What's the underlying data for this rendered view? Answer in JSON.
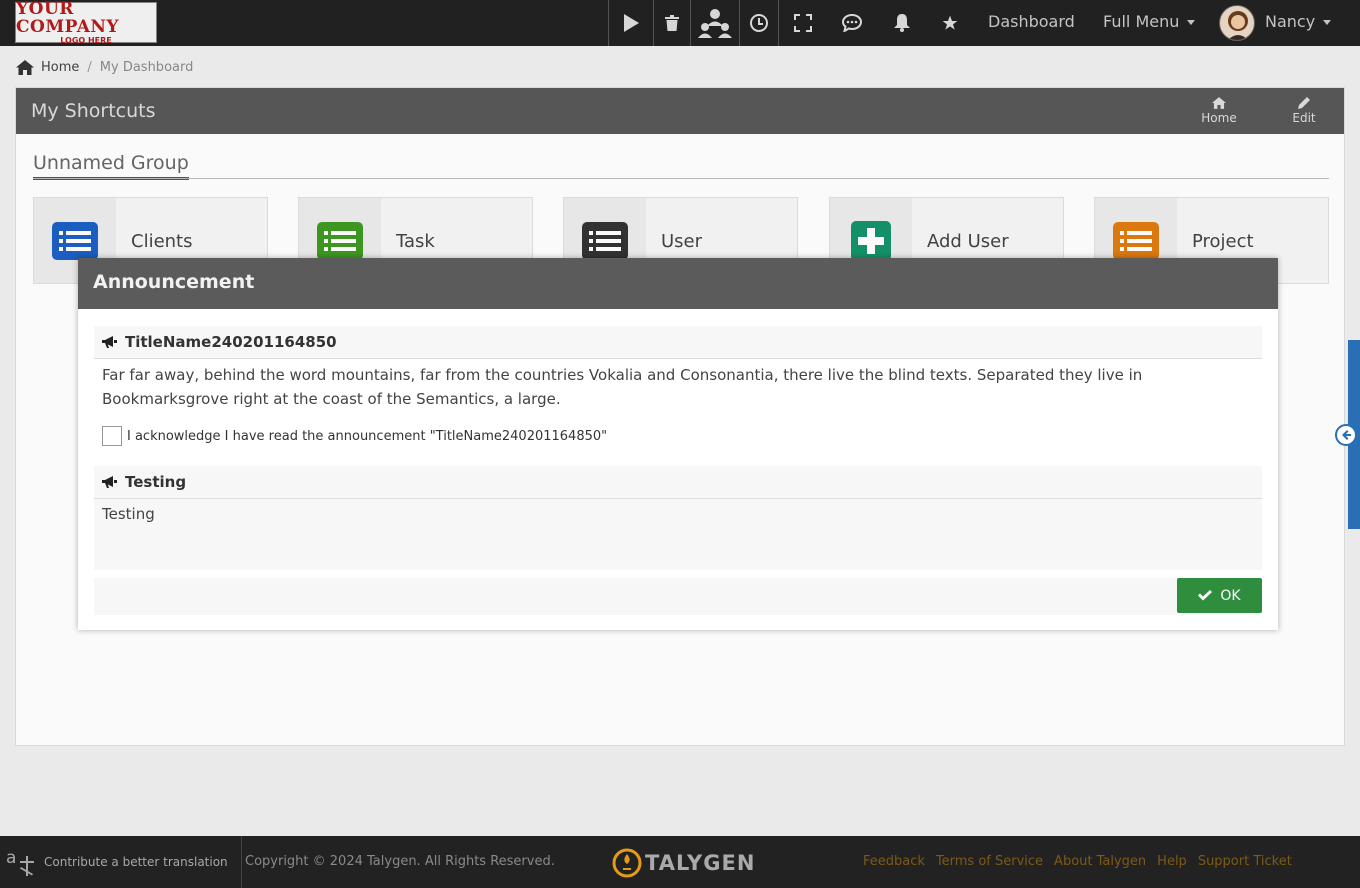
{
  "topbar": {
    "logo_line1": "YOUR COMPANY",
    "logo_line2": "LOGO HERE",
    "icons": [
      "play-icon",
      "trash-icon",
      "user-group-icon",
      "clock-icon",
      "fullscreen-icon",
      "chat-icon",
      "bell-icon",
      "star-icon"
    ],
    "dashboard_label": "Dashboard",
    "full_menu_label": "Full Menu",
    "user_name": "Nancy"
  },
  "breadcrumb": {
    "home": "Home",
    "separator": "/",
    "current": "My Dashboard"
  },
  "shortcuts": {
    "title": "My Shortcuts",
    "home_btn": "Home",
    "edit_btn": "Edit",
    "group_title": "Unnamed Group",
    "tiles": [
      {
        "label": "Clients",
        "icon": "list-icon",
        "color": "#1d5fc4"
      },
      {
        "label": "Task",
        "icon": "list-icon",
        "color": "#3f9a22"
      },
      {
        "label": "User",
        "icon": "list-icon",
        "color": "#333333"
      },
      {
        "label": "Add User",
        "icon": "plus-icon",
        "color": "#14936a"
      },
      {
        "label": "Project",
        "icon": "list-icon",
        "color": "#e07b10"
      }
    ]
  },
  "modal": {
    "title": "Announcement",
    "announcements": [
      {
        "title": "TitleName240201164850",
        "body": "Far far away, behind the word mountains, far from the countries Vokalia and Consonantia, there live the blind texts. Separated they live in Bookmarksgrove right at the coast of the Semantics, a large.",
        "ack_label": "I acknowledge I have read the announcement \"TitleName240201164850\"",
        "acknowledged": false
      },
      {
        "title": "Testing",
        "body": "Testing"
      }
    ],
    "ok_label": "OK"
  },
  "footer": {
    "translate_label": "Contribute a better translation",
    "copyright": "Copyright © 2024 Talygen. All Rights Reserved.",
    "brand": "TALYGEN",
    "links": [
      "Feedback",
      "Terms of Service",
      "About Talygen",
      "Help",
      "Support Ticket"
    ]
  },
  "colors": {
    "topbar_bg": "#222222",
    "ok_button": "#2e8e3e",
    "side_tab": "#2a6fb5"
  }
}
